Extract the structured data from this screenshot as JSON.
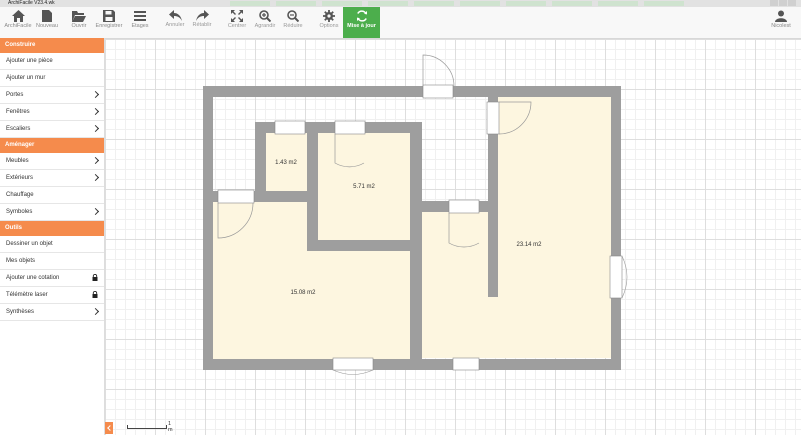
{
  "window": {
    "title": "ArchiFacile V23.4.wk"
  },
  "toolbar": {
    "buttons": [
      {
        "id": "home",
        "label": "ArchiFacile"
      },
      {
        "id": "new",
        "label": "Nouveau"
      },
      {
        "id": "open",
        "label": "Ouvrir"
      },
      {
        "id": "save",
        "label": "Enregistrer"
      },
      {
        "id": "floors",
        "label": "Etages"
      },
      {
        "id": "undo",
        "label": "Annuler"
      },
      {
        "id": "redo",
        "label": "Rétablir"
      },
      {
        "id": "center",
        "label": "Centrer"
      },
      {
        "id": "zoom_in",
        "label": "Agrandir"
      },
      {
        "id": "zoom_out",
        "label": "Réduire"
      },
      {
        "id": "options",
        "label": "Options"
      },
      {
        "id": "update",
        "label": "Mise à jour"
      }
    ],
    "user": {
      "label": "Nicolest"
    }
  },
  "sidebar": {
    "sections": [
      {
        "title": "Construire",
        "items": [
          {
            "label": "Ajouter une pièce",
            "chevron": false,
            "lock": false
          },
          {
            "label": "Ajouter un mur",
            "chevron": false,
            "lock": false
          },
          {
            "label": "Portes",
            "chevron": true,
            "lock": false
          },
          {
            "label": "Fenêtres",
            "chevron": true,
            "lock": false
          },
          {
            "label": "Escaliers",
            "chevron": true,
            "lock": false
          }
        ]
      },
      {
        "title": "Aménager",
        "items": [
          {
            "label": "Meubles",
            "chevron": true,
            "lock": false
          },
          {
            "label": "Extérieurs",
            "chevron": true,
            "lock": false
          },
          {
            "label": "Chauffage",
            "chevron": false,
            "lock": false
          },
          {
            "label": "Symboles",
            "chevron": true,
            "lock": false
          }
        ]
      },
      {
        "title": "Outils",
        "items": [
          {
            "label": "Dessiner un objet",
            "chevron": false,
            "lock": false
          },
          {
            "label": "Mes objets",
            "chevron": false,
            "lock": false
          },
          {
            "label": "Ajouter une cotation",
            "chevron": false,
            "lock": true
          },
          {
            "label": "Télémètre laser",
            "chevron": false,
            "lock": true
          },
          {
            "label": "Synthèses",
            "chevron": true,
            "lock": false
          }
        ]
      }
    ]
  },
  "plan": {
    "rooms": [
      {
        "label": "1.43 m2"
      },
      {
        "label": "5.71 m2"
      },
      {
        "label": "23.14 m2"
      },
      {
        "label": "15.08 m2"
      }
    ],
    "scale": {
      "label": "1 m"
    }
  },
  "colors": {
    "accent": "#f58b4c",
    "update_button": "#4cae4c",
    "wall": "#9e9e9e",
    "room_fill": "#fdf6e0"
  }
}
